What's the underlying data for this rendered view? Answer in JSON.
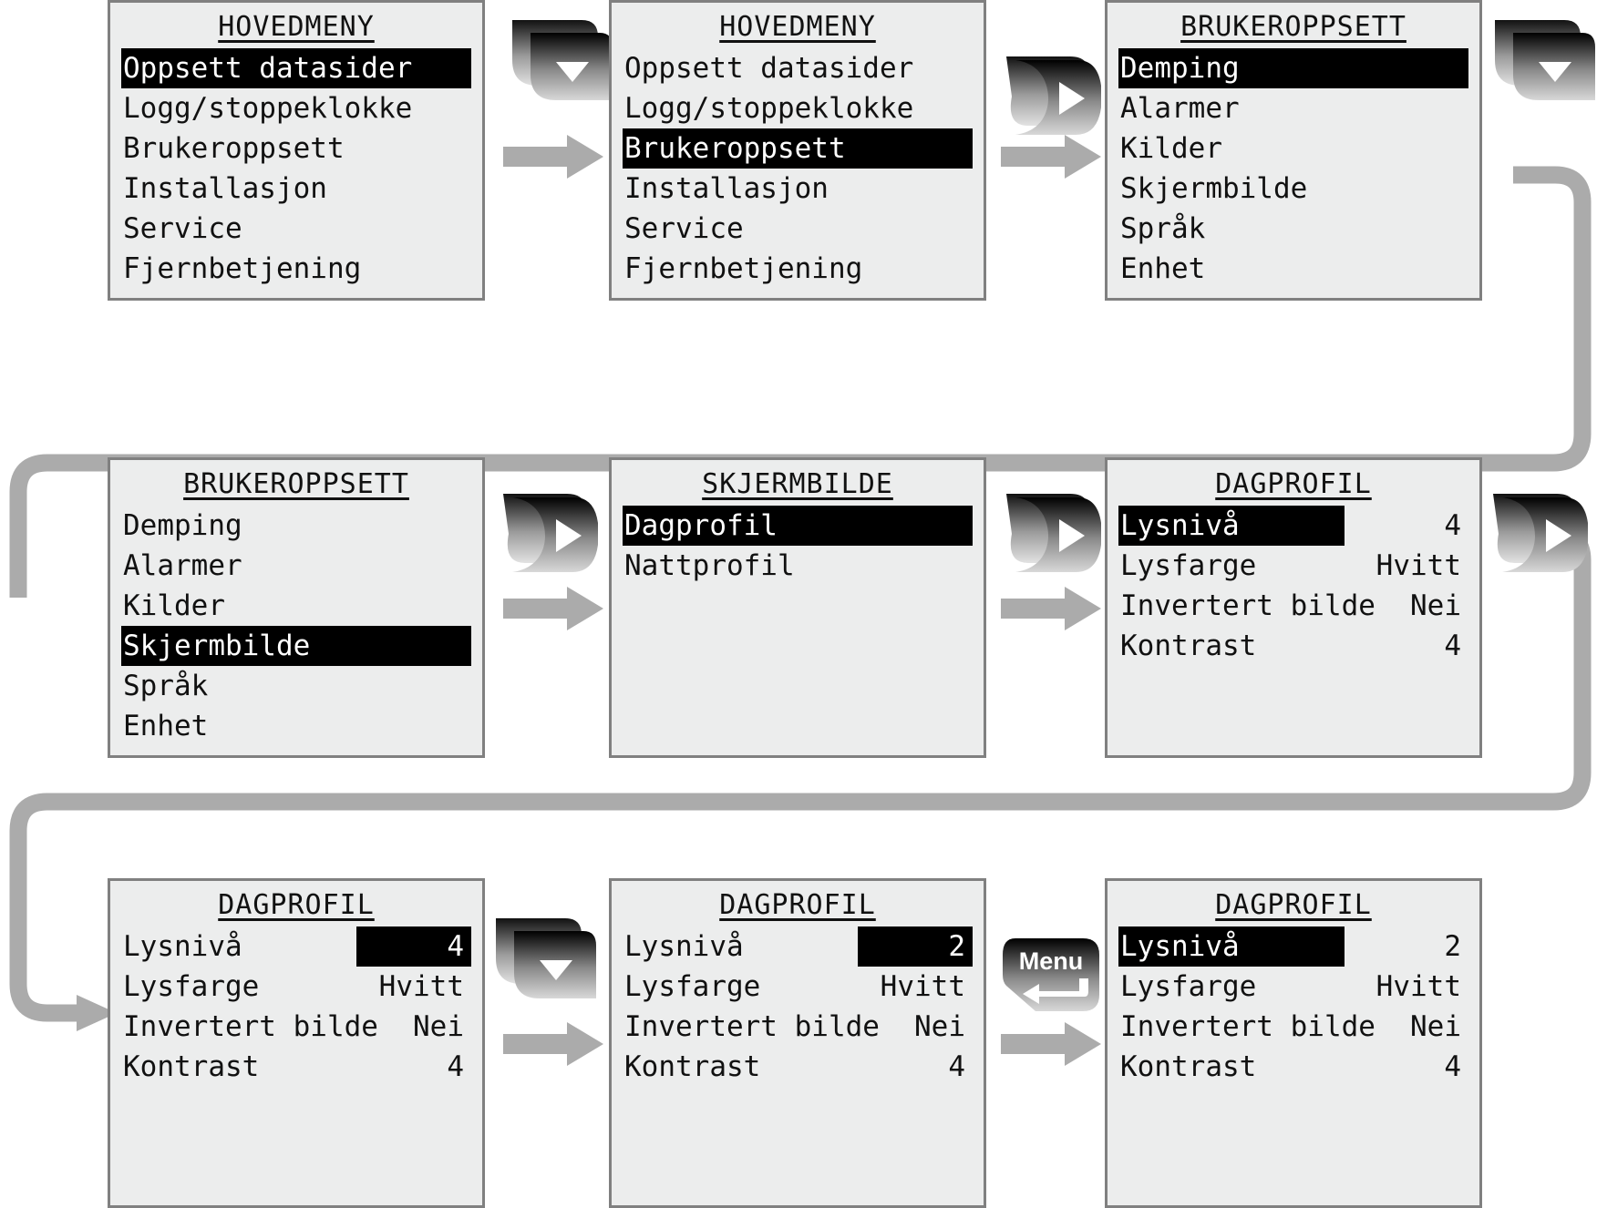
{
  "diagram": {
    "title": "Menu navigation flow",
    "accent_gray": "#ababab",
    "lcd_bg": "#eceded",
    "lcd_border": "#808080",
    "highlight_bg": "#000000",
    "highlight_fg": "#ffffff"
  },
  "panels": [
    {
      "id": "p1",
      "title": "HOVEDMENY",
      "rows": [
        {
          "label": "Oppsett datasider",
          "value": "",
          "highlight": "full"
        },
        {
          "label": "Logg/stoppeklokke",
          "value": "",
          "highlight": "none"
        },
        {
          "label": "Brukeroppsett",
          "value": "",
          "highlight": "none"
        },
        {
          "label": "Installasjon",
          "value": "",
          "highlight": "none"
        },
        {
          "label": "Service",
          "value": "",
          "highlight": "none"
        },
        {
          "label": "Fjernbetjening",
          "value": "",
          "highlight": "none"
        }
      ]
    },
    {
      "id": "p2",
      "title": "HOVEDMENY",
      "rows": [
        {
          "label": "Oppsett datasider",
          "value": "",
          "highlight": "none"
        },
        {
          "label": "Logg/stoppeklokke",
          "value": "",
          "highlight": "none"
        },
        {
          "label": "Brukeroppsett",
          "value": "",
          "highlight": "full"
        },
        {
          "label": "Installasjon",
          "value": "",
          "highlight": "none"
        },
        {
          "label": "Service",
          "value": "",
          "highlight": "none"
        },
        {
          "label": "Fjernbetjening",
          "value": "",
          "highlight": "none"
        }
      ]
    },
    {
      "id": "p3",
      "title": "BRUKEROPPSETT",
      "rows": [
        {
          "label": "Demping",
          "value": "",
          "highlight": "full"
        },
        {
          "label": "Alarmer",
          "value": "",
          "highlight": "none"
        },
        {
          "label": "Kilder",
          "value": "",
          "highlight": "none"
        },
        {
          "label": "Skjermbilde",
          "value": "",
          "highlight": "none"
        },
        {
          "label": "Språk",
          "value": "",
          "highlight": "none"
        },
        {
          "label": "Enhet",
          "value": "",
          "highlight": "none"
        }
      ]
    },
    {
      "id": "p4",
      "title": "BRUKEROPPSETT",
      "rows": [
        {
          "label": "Demping",
          "value": "",
          "highlight": "none"
        },
        {
          "label": "Alarmer",
          "value": "",
          "highlight": "none"
        },
        {
          "label": "Kilder",
          "value": "",
          "highlight": "none"
        },
        {
          "label": "Skjermbilde",
          "value": "",
          "highlight": "full"
        },
        {
          "label": "Språk",
          "value": "",
          "highlight": "none"
        },
        {
          "label": "Enhet",
          "value": "",
          "highlight": "none"
        }
      ]
    },
    {
      "id": "p5",
      "title": "SKJERMBILDE",
      "rows": [
        {
          "label": "Dagprofil",
          "value": "",
          "highlight": "full"
        },
        {
          "label": "Nattprofil",
          "value": "",
          "highlight": "none"
        }
      ]
    },
    {
      "id": "p6",
      "title": "DAGPROFIL",
      "rows": [
        {
          "label": "Lysnivå",
          "value": "4",
          "highlight": "label"
        },
        {
          "label": "Lysfarge",
          "value": "Hvitt",
          "highlight": "none"
        },
        {
          "label": "Invertert bilde",
          "value": "Nei",
          "highlight": "none"
        },
        {
          "label": "Kontrast",
          "value": "4",
          "highlight": "none"
        }
      ]
    },
    {
      "id": "p7",
      "title": "DAGPROFIL",
      "rows": [
        {
          "label": "Lysnivå",
          "value": "4",
          "highlight": "value"
        },
        {
          "label": "Lysfarge",
          "value": "Hvitt",
          "highlight": "none"
        },
        {
          "label": "Invertert bilde",
          "value": "Nei",
          "highlight": "none"
        },
        {
          "label": "Kontrast",
          "value": "4",
          "highlight": "none"
        }
      ]
    },
    {
      "id": "p8",
      "title": "DAGPROFIL",
      "rows": [
        {
          "label": "Lysnivå",
          "value": "2",
          "highlight": "value"
        },
        {
          "label": "Lysfarge",
          "value": "Hvitt",
          "highlight": "none"
        },
        {
          "label": "Invertert bilde",
          "value": "Nei",
          "highlight": "none"
        },
        {
          "label": "Kontrast",
          "value": "4",
          "highlight": "none"
        }
      ]
    },
    {
      "id": "p9",
      "title": "DAGPROFIL",
      "rows": [
        {
          "label": "Lysnivå",
          "value": "2",
          "highlight": "label"
        },
        {
          "label": "Lysfarge",
          "value": "Hvitt",
          "highlight": "none"
        },
        {
          "label": "Invertert bilde",
          "value": "Nei",
          "highlight": "none"
        },
        {
          "label": "Kontrast",
          "value": "4",
          "highlight": "none"
        }
      ]
    }
  ],
  "keys": [
    {
      "id": "k1",
      "icon": "down-arrow-key",
      "label": ""
    },
    {
      "id": "k2",
      "icon": "right-arrow-key",
      "label": ""
    },
    {
      "id": "k3",
      "icon": "down-arrow-key",
      "label": ""
    },
    {
      "id": "k4",
      "icon": "right-arrow-key",
      "label": ""
    },
    {
      "id": "k5",
      "icon": "right-arrow-key",
      "label": ""
    },
    {
      "id": "k6",
      "icon": "right-arrow-key",
      "label": ""
    },
    {
      "id": "k7",
      "icon": "down-arrow-key",
      "label": ""
    },
    {
      "id": "k8",
      "icon": "menu-enter-key",
      "label": "Menu"
    }
  ]
}
